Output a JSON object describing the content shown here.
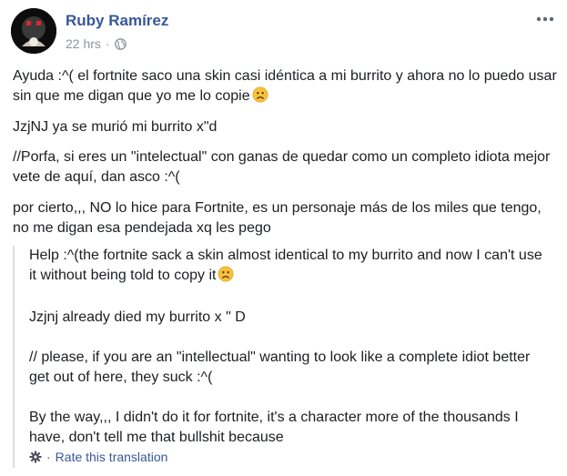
{
  "post": {
    "author": "Ruby Ramírez",
    "time": "22 hrs",
    "separator": "·",
    "icons": {
      "privacy": "globe-icon",
      "menu": "more-options-icon",
      "emoji": "frowning-face-emoji",
      "rate": "gear-icon"
    },
    "paragraphs": [
      "Ayuda :^( el fortnite saco una skin casi idéntica a mi burrito y ahora no lo puedo usar sin que me digan que yo me lo copie",
      "JzjNJ ya se murió mi burrito x\"d",
      "//Porfa, si eres un \"intelectual\" con ganas de quedar como un completo idiota mejor vete de aquí, dan asco :^(",
      "por cierto,,, NO lo hice para Fortnite, es un personaje más de los miles que tengo, no me digan esa pendejada xq les pego"
    ],
    "translation": {
      "paragraphs": [
        "Help :^(the fortnite sack a skin almost identical to my burrito and now I can't use it without being told to copy it",
        "Jzjnj already died my burrito x \" D",
        "// please, if you are an \"intellectual\" wanting to look like a complete idiot better get out of here, they suck :^(",
        "By the way,,, I didn't do it for fortnite, it's a character more of the thousands I have, don't tell me that bullshit because"
      ],
      "separator": "·",
      "rate_label": "Rate this translation"
    }
  },
  "colors": {
    "link": "#385898",
    "meta": "#90949c",
    "text": "#1c1e21",
    "border": "#dddfe2"
  }
}
